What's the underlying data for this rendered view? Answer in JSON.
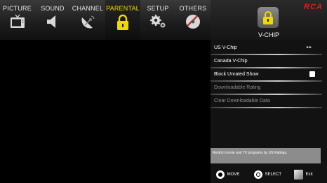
{
  "tabs": [
    {
      "label": "PICTURE",
      "icon": "tv-icon"
    },
    {
      "label": "SOUND",
      "icon": "speaker-icon"
    },
    {
      "label": "CHANNEL",
      "icon": "satellite-dish-icon"
    },
    {
      "label": "PARENTAL",
      "icon": "lock-icon",
      "active": true
    },
    {
      "label": "SETUP",
      "icon": "gears-icon"
    },
    {
      "label": "OTHERS",
      "icon": "disc-icon"
    }
  ],
  "brand": {
    "logo": "RCA"
  },
  "section": {
    "title": "V-CHIP",
    "icon": "lock-icon"
  },
  "menu": [
    {
      "label": "US V-Chip",
      "state": "submenu-arrows",
      "enabled": true
    },
    {
      "label": "Canada V-Chip",
      "enabled": true
    },
    {
      "label": "Block Unrated Show",
      "state": "checkbox",
      "enabled": true
    },
    {
      "label": "Downloadable Rating",
      "enabled": false
    },
    {
      "label": "Clear Downloadable Data",
      "enabled": false
    }
  ],
  "help": {
    "text": "Restrict movie and TV programs by US Ratings."
  },
  "footer": {
    "move": "MOVE",
    "select": "SELECT",
    "exit": "Exit"
  },
  "colors": {
    "active_tab": "#f0d800",
    "brand": "#d62020",
    "lock": "#f0d800"
  }
}
